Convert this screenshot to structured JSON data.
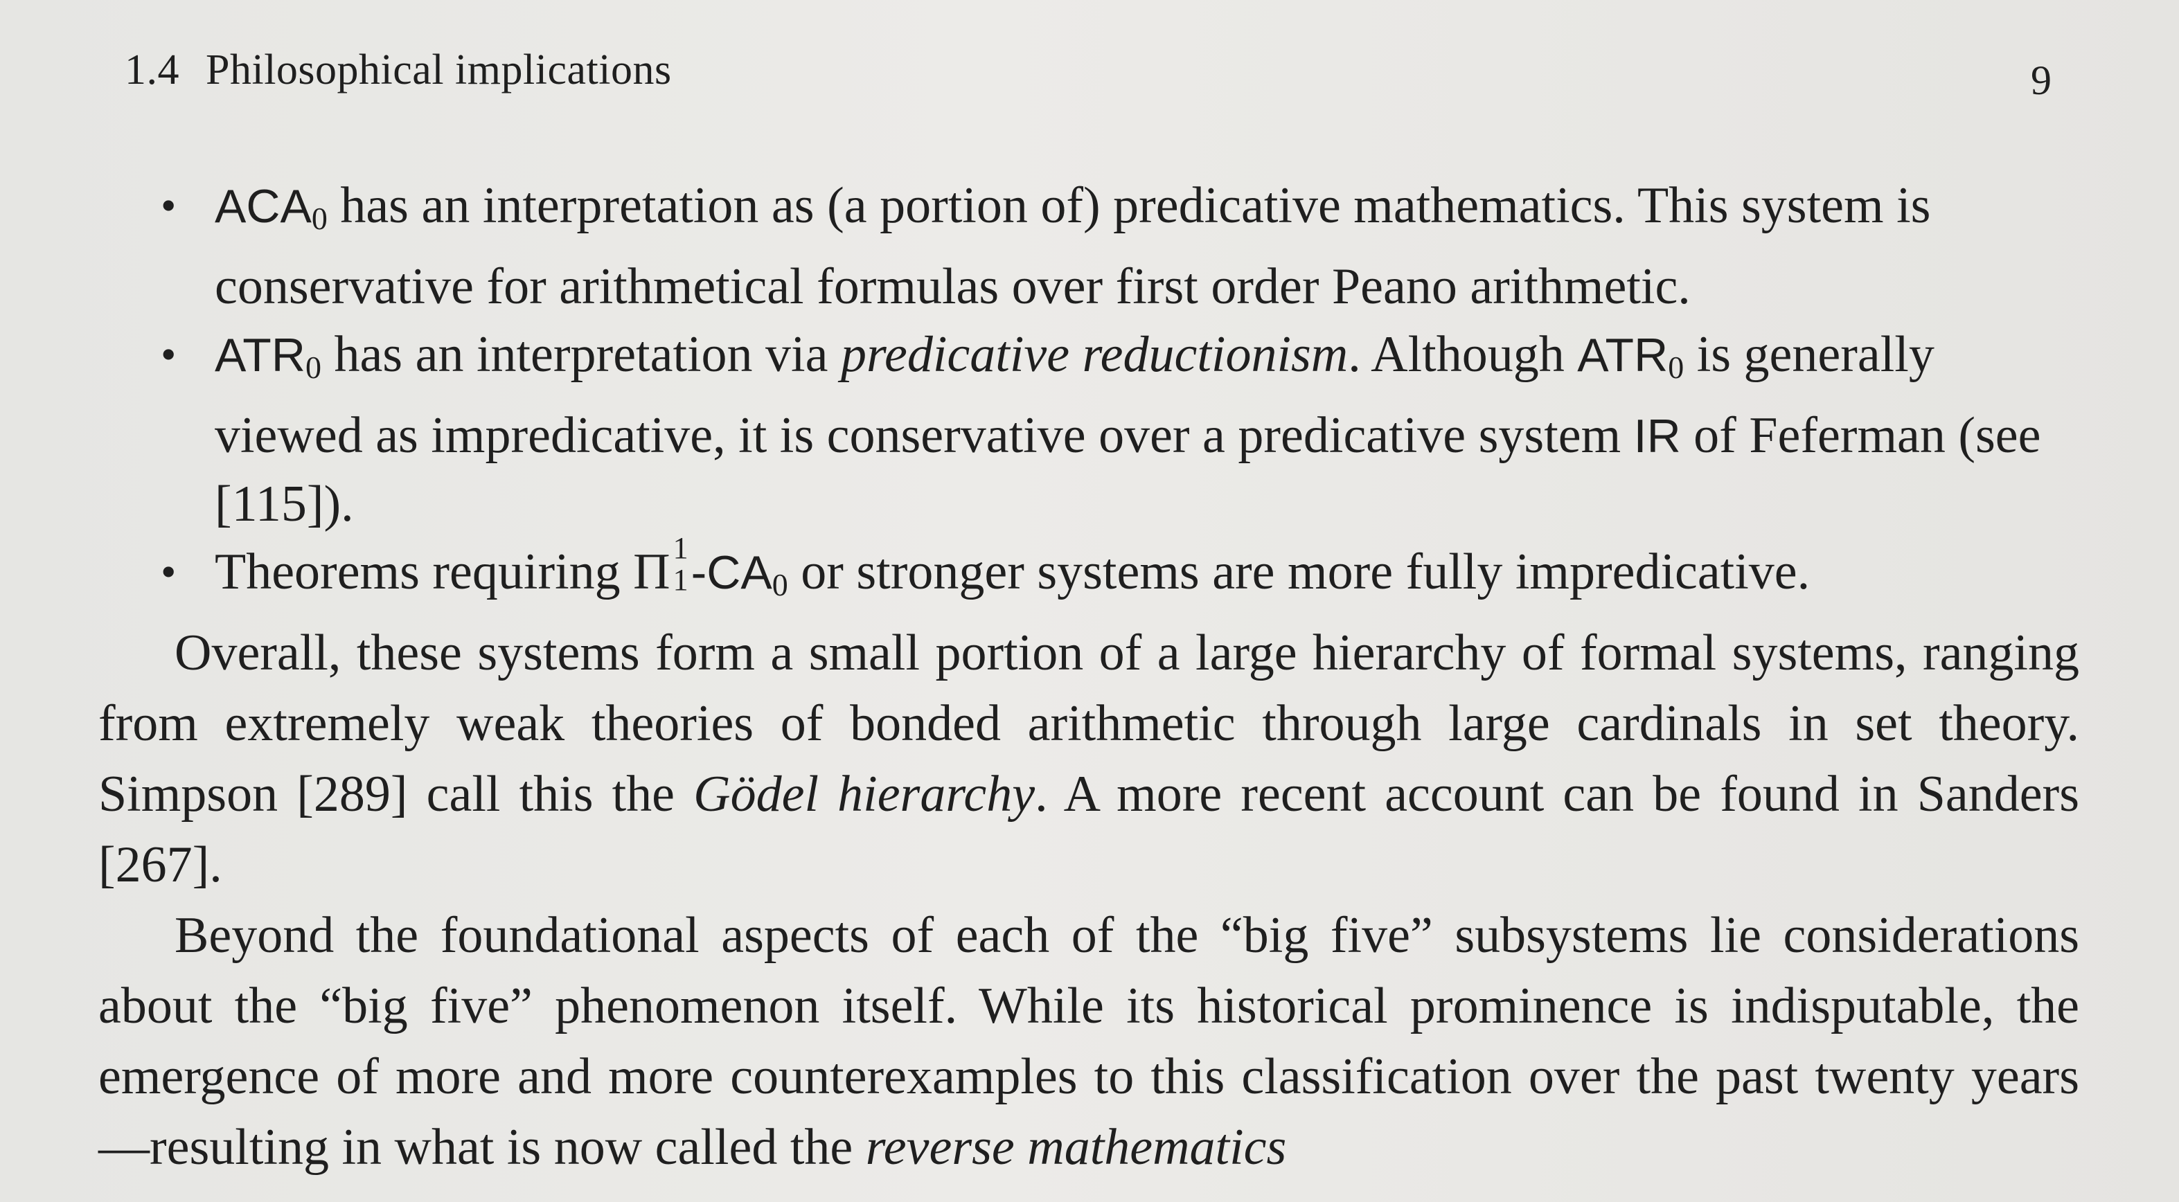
{
  "header": {
    "section_number": "1.4",
    "section_title": "Philosophical implications",
    "page_number": "9"
  },
  "bullets": [
    {
      "system": "ACA",
      "subscript": "0",
      "text1": " has an interpretation as (a portion of) predicative mathematics. This system is conservative for arithmetical formulas over first order Peano arithmetic."
    },
    {
      "system": "ATR",
      "subscript": "0",
      "text1": " has an interpretation via ",
      "italic": "predicative reductionism",
      "text2": ". Although ",
      "system2": "ATR",
      "subscript2": "0",
      "text3": " is generally viewed as impredicative, it is conservative over a predicative system ",
      "system3": "IR",
      "text4": " of Feferman (see [115])."
    },
    {
      "text1": "Theorems requiring ",
      "pi": "Π",
      "pi_sup": "1",
      "pi_sub": "1",
      "system": "-CA",
      "subscript": "0",
      "text2": " or stronger systems are more fully impredicative."
    }
  ],
  "paragraph1": {
    "text1": "Overall, these systems form a small portion of a large hierarchy of formal systems, ranging from extremely weak theories of bonded arithmetic through large cardinals in set theory. Simpson [289] call this the ",
    "italic": "Gödel hierarchy",
    "text2": ". A more recent account can be found in Sanders [267]."
  },
  "paragraph2": {
    "text1": "Beyond the foundational aspects of each of the “big five” subsystems lie considerations about the “big five” phenomenon itself. While its historical prominence is indisputable, the emergence of more and more counterexamples to this classification over the past twenty years—resulting in what is now called the ",
    "italic": "reverse mathematics"
  }
}
